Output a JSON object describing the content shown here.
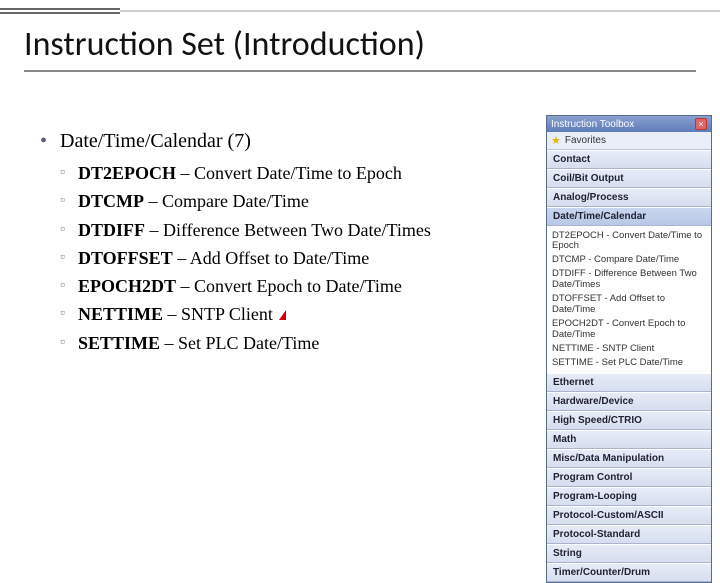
{
  "title": "Instruction Set (Introduction)",
  "section": {
    "heading": "Date/Time/Calendar (7)"
  },
  "instructions": [
    {
      "code": "DT2EPOCH",
      "desc": " – Convert Date/Time to Epoch"
    },
    {
      "code": "DTCMP",
      "desc": " – Compare Date/Time"
    },
    {
      "code": "DTDIFF",
      "desc": " – Difference Between Two Date/Times"
    },
    {
      "code": "DTOFFSET",
      "desc": " – Add Offset to Date/Time"
    },
    {
      "code": "EPOCH2DT",
      "desc": " – Convert Epoch to Date/Time"
    },
    {
      "code": "NETTIME",
      "desc": " – SNTP Client"
    },
    {
      "code": "SETTIME",
      "desc": " – Set PLC Date/Time"
    }
  ],
  "toolbox": {
    "title": "Instruction Toolbox",
    "favorites": "Favorites",
    "categories_top": [
      "Contact",
      "Coil/Bit Output",
      "Analog/Process"
    ],
    "selected_category": "Date/Time/Calendar",
    "selected_items": [
      "DT2EPOCH - Convert Date/Time to Epoch",
      "DTCMP - Compare Date/Time",
      "DTDIFF - Difference Between Two Date/Times",
      "DTOFFSET - Add Offset to Date/Time",
      "EPOCH2DT - Convert Epoch to Date/Time",
      "NETTIME - SNTP Client",
      "SETTIME - Set PLC Date/Time"
    ],
    "categories_bottom": [
      "Ethernet",
      "Hardware/Device",
      "High Speed/CTRIO",
      "Math",
      "Misc/Data Manipulation",
      "Program Control",
      "Program-Looping",
      "Protocol-Custom/ASCII",
      "Protocol-Standard",
      "String",
      "Timer/Counter/Drum"
    ]
  }
}
